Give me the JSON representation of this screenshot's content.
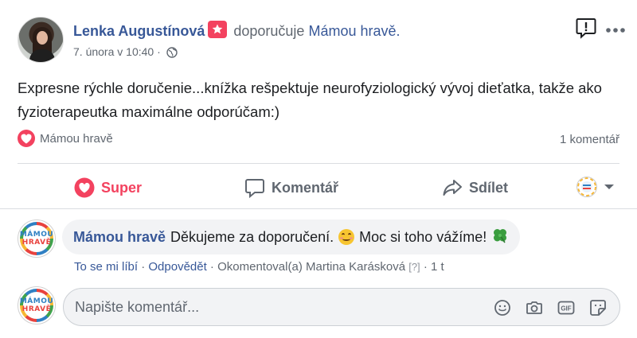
{
  "post": {
    "author": "Lenka Augustínová",
    "verb": "doporučuje",
    "page": "Mámou hravě.",
    "timestamp": "7. února v 10:40",
    "separator": " · ",
    "text": "Expresne rýchle doručenie...knížka rešpektuje neurofyziologický vývoj dieťatka, takže ako fyzioterapeutka maximálne odporúčam:)",
    "reaction_by": "Mámou hravě",
    "comment_count": "1 komentář"
  },
  "actions": {
    "super": "Super",
    "comment": "Komentář",
    "share": "Sdílet"
  },
  "comment": {
    "author": "Mámou hravě",
    "text_before": "Děkujeme za doporučení.",
    "text_after": "Moc si toho vážíme!",
    "like": "To se mi líbí",
    "dot1": " · ",
    "reply": "Odpovědět",
    "dot2": " · ",
    "edited_by": "Okomentoval(a) Martina Karásková",
    "q": "[?]",
    "dot3": " · ",
    "age": "1 t"
  },
  "logo": {
    "line1": "MÁMOU",
    "line2": "HRAVĚ"
  },
  "composer": {
    "placeholder": "Napište komentář..."
  },
  "colors": {
    "link": "#385898",
    "super": "#f3425f",
    "muted": "#606770"
  },
  "icons": [
    "recommend-star-icon",
    "globe-icon",
    "report-icon",
    "more-icon",
    "heart-icon",
    "comment-icon",
    "share-icon",
    "chevron-down-icon",
    "smile-icon",
    "clover-icon",
    "emoji-icon",
    "camera-icon",
    "gif-icon",
    "sticker-icon"
  ]
}
